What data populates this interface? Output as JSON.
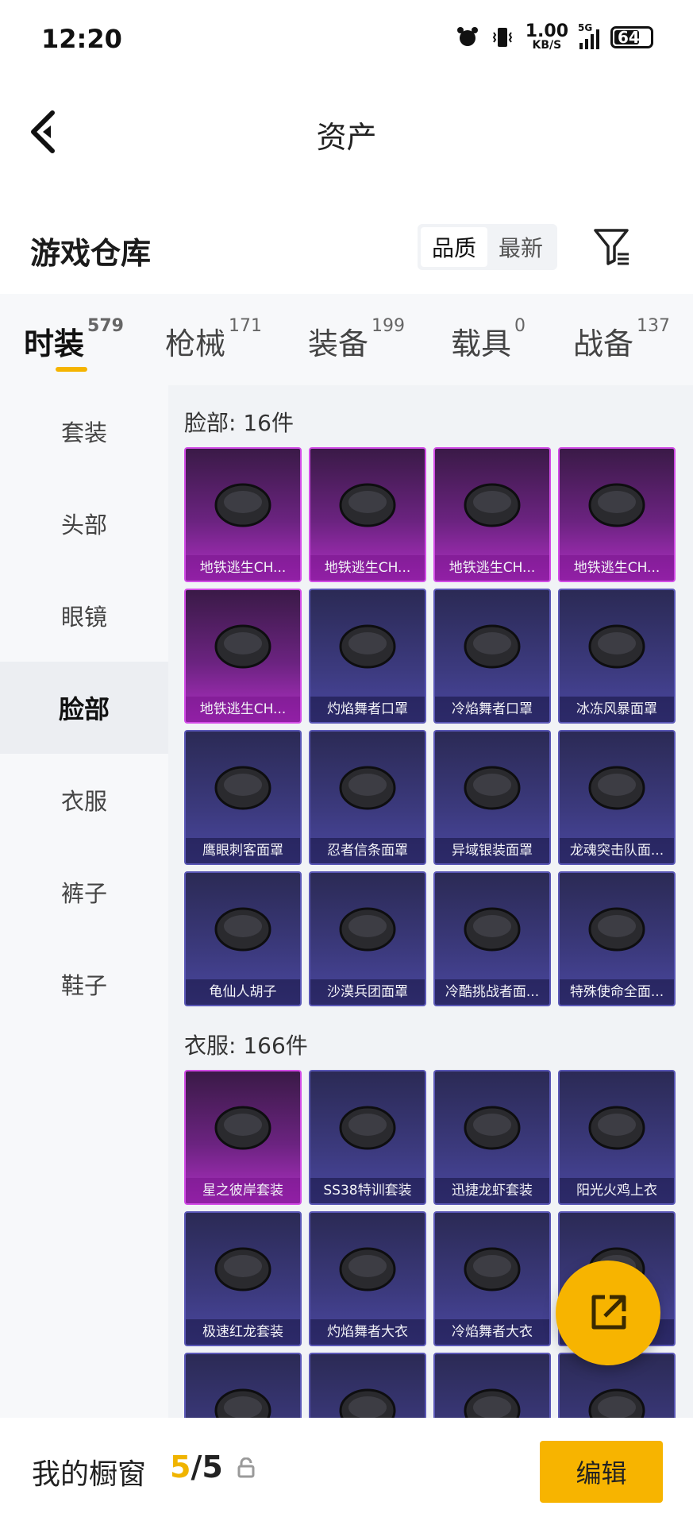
{
  "status_bar": {
    "time": "12:20",
    "net_speed_value": "1.00",
    "net_speed_unit": "KB/S",
    "network": "5G",
    "battery": "64",
    "icons": [
      "alarm-icon",
      "vibrate-icon",
      "signal-icon",
      "battery-icon"
    ]
  },
  "header": {
    "title": "资产",
    "back_icon": "back-arrow-icon"
  },
  "warehouse": {
    "title": "游戏仓库",
    "sort_options": [
      "品质",
      "最新"
    ],
    "sort_active": "品质",
    "filter_icon": "filter-icon"
  },
  "tabs": [
    {
      "label": "时装",
      "count": "579"
    },
    {
      "label": "枪械",
      "count": "171"
    },
    {
      "label": "装备",
      "count": "199"
    },
    {
      "label": "载具",
      "count": "0"
    },
    {
      "label": "战备",
      "count": "137"
    }
  ],
  "active_tab": "时装",
  "sidebar": {
    "items": [
      "套装",
      "头部",
      "眼镜",
      "脸部",
      "衣服",
      "裤子",
      "鞋子"
    ],
    "active": "脸部"
  },
  "sections": [
    {
      "title": "脸部: 16件",
      "items": [
        {
          "label": "地铁逃生CH...",
          "rarity": "purple"
        },
        {
          "label": "地铁逃生CH...",
          "rarity": "purple"
        },
        {
          "label": "地铁逃生CH...",
          "rarity": "purple"
        },
        {
          "label": "地铁逃生CH...",
          "rarity": "purple"
        },
        {
          "label": "地铁逃生CH...",
          "rarity": "purple"
        },
        {
          "label": "灼焰舞者口罩",
          "rarity": "blue"
        },
        {
          "label": "冷焰舞者口罩",
          "rarity": "blue"
        },
        {
          "label": "冰冻风暴面罩",
          "rarity": "blue"
        },
        {
          "label": "鹰眼刺客面罩",
          "rarity": "blue"
        },
        {
          "label": "忍者信条面罩",
          "rarity": "blue"
        },
        {
          "label": "异域银装面罩",
          "rarity": "blue"
        },
        {
          "label": "龙魂突击队面...",
          "rarity": "blue"
        },
        {
          "label": "龟仙人胡子",
          "rarity": "blue"
        },
        {
          "label": "沙漠兵团面罩",
          "rarity": "blue"
        },
        {
          "label": "冷酷挑战者面...",
          "rarity": "blue"
        },
        {
          "label": "特殊使命全面...",
          "rarity": "blue"
        }
      ]
    },
    {
      "title": "衣服: 166件",
      "items": [
        {
          "label": "星之彼岸套装",
          "rarity": "purple"
        },
        {
          "label": "SS38特训套装",
          "rarity": "blue"
        },
        {
          "label": "迅捷龙虾套装",
          "rarity": "blue"
        },
        {
          "label": "阳光火鸡上衣",
          "rarity": "blue"
        },
        {
          "label": "极速红龙套装",
          "rarity": "blue"
        },
        {
          "label": "灼焰舞者大衣",
          "rarity": "blue"
        },
        {
          "label": "冷焰舞者大衣",
          "rarity": "blue"
        },
        {
          "label": "",
          "rarity": "blue"
        },
        {
          "label": "",
          "rarity": "blue"
        },
        {
          "label": "",
          "rarity": "blue"
        },
        {
          "label": "",
          "rarity": "blue"
        },
        {
          "label": "",
          "rarity": "blue"
        }
      ]
    }
  ],
  "fab": {
    "icon": "share-external-icon"
  },
  "bottom_bar": {
    "showcase_label": "我的橱窗",
    "showcase_current": "5",
    "showcase_sep": "/",
    "showcase_total": "5",
    "lock_icon": "lock-icon",
    "edit_label": "编辑"
  }
}
